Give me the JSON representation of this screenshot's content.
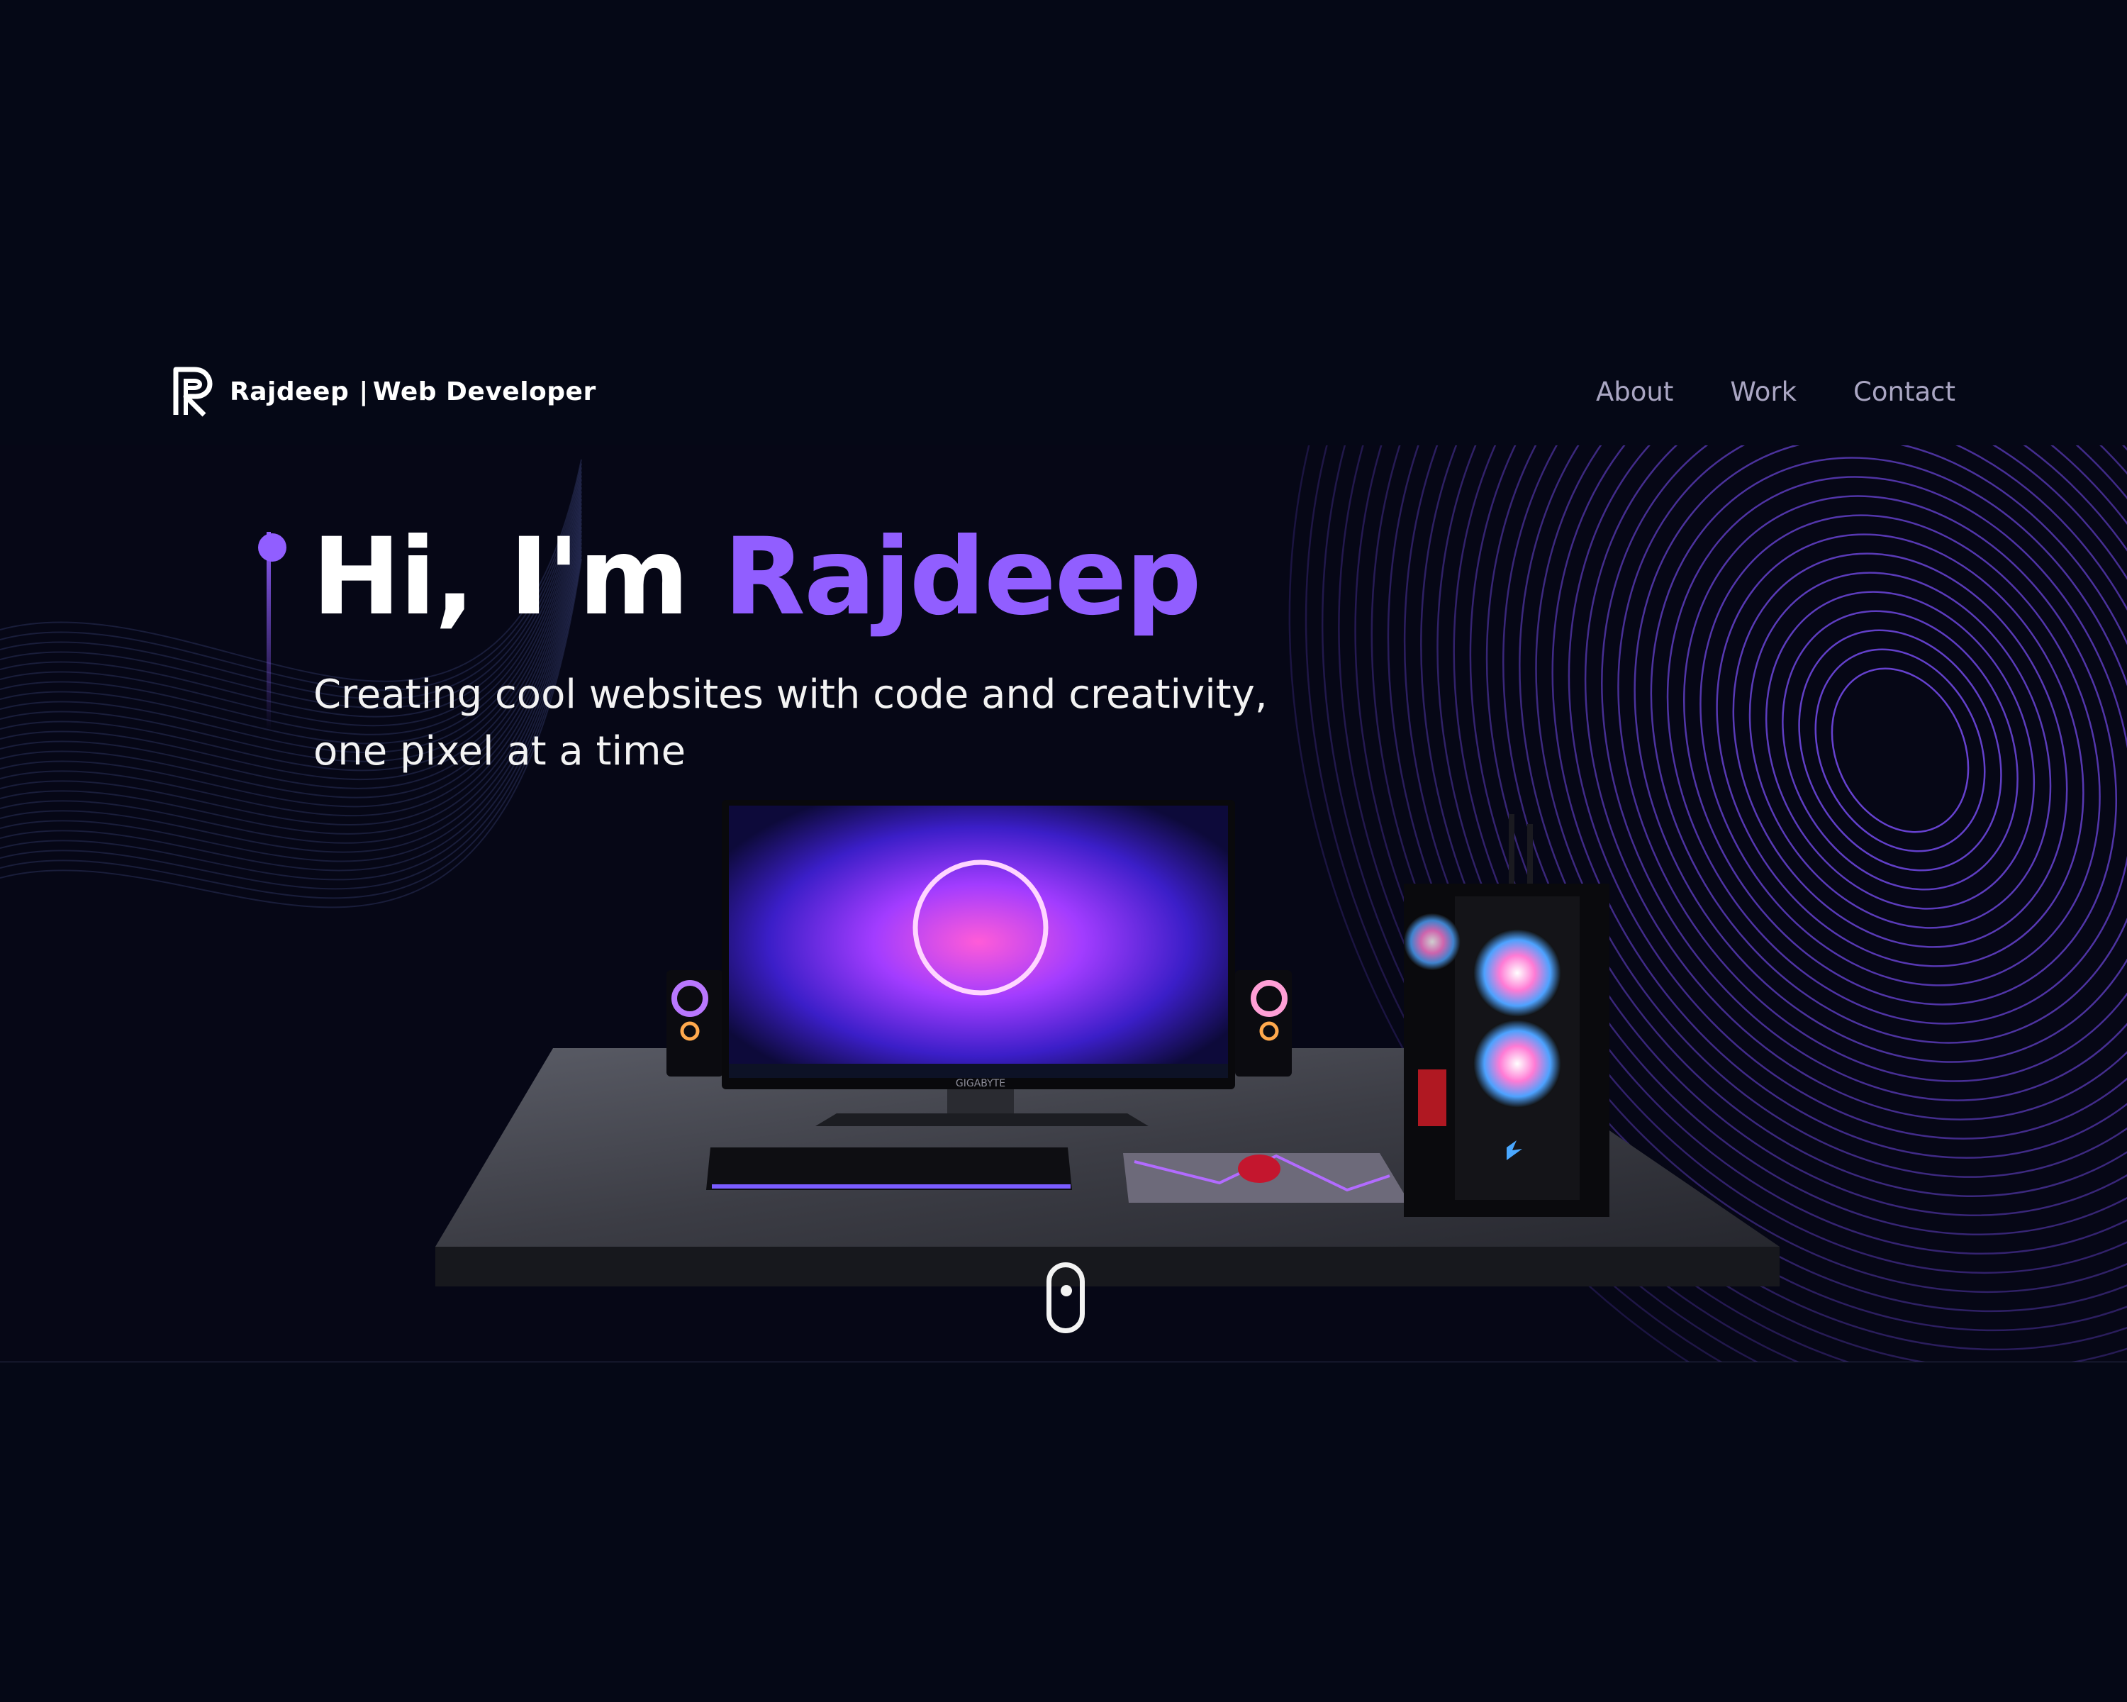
{
  "navbar": {
    "brand_name": "Rajdeep",
    "brand_divider": "|",
    "brand_role": "Web Developer",
    "links": [
      {
        "label": "About"
      },
      {
        "label": "Work"
      },
      {
        "label": "Contact"
      }
    ]
  },
  "hero": {
    "title_prefix": "Hi, I'm",
    "title_name": "Rajdeep",
    "subtitle_line1": "Creating cool websites with code and creativity,",
    "subtitle_line2": "one pixel at a time",
    "monitor_brand": "GIGABYTE"
  },
  "colors": {
    "background": "#050816",
    "accent": "#915eff",
    "nav_text": "#aaa6c3",
    "text": "#ffffff"
  },
  "icons": {
    "logo": "letter-r-logo",
    "scroll": "mouse-scroll-icon"
  }
}
